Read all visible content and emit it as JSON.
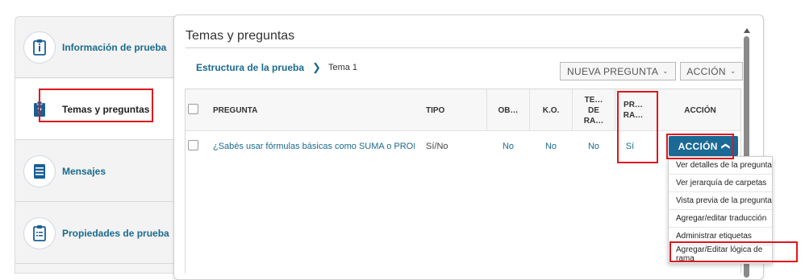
{
  "sidebar": {
    "items": [
      {
        "label": "Información de prueba",
        "icon": "info-icon"
      },
      {
        "label": "Temas y preguntas",
        "icon": "clipboard-question-icon",
        "active": true
      },
      {
        "label": "Mensajes",
        "icon": "message-icon"
      },
      {
        "label": "Propiedades de prueba",
        "icon": "document-list-icon"
      }
    ]
  },
  "panel": {
    "title": "Temas y preguntas"
  },
  "breadcrumb": {
    "root": "Estructura de la prueba",
    "current": "Tema 1"
  },
  "toolbar": {
    "new_question": "NUEVA PREGUNTA",
    "action": "ACCIÓN"
  },
  "table": {
    "headers": {
      "question": "PREGUNTA",
      "type": "TIPO",
      "ob": "OB…",
      "ko": "K.O.",
      "te": [
        "TE…",
        "DE",
        "RA…"
      ],
      "pr": [
        "PR…",
        "RA…"
      ],
      "action": "ACCIÓN"
    },
    "rows": [
      {
        "question": "¿Sabés usar fórmulas básicas como SUMA o PROMEDIC",
        "type": "Sí/No",
        "ob": "No",
        "ko": "No",
        "te": "No",
        "pr": "Sí",
        "action": "ACCIÓN"
      }
    ]
  },
  "action_menu": {
    "items": [
      "Ver detalles de la pregunta",
      "Ver jerarquía de carpetas",
      "Vista previa de la pregunta",
      "Agregar/editar traducción",
      "Administrar etiquetas",
      "Agregar/Editar lógica de rama"
    ]
  },
  "colors": {
    "accent": "#1b6a96",
    "link": "#1b6a8e",
    "highlight": "#e0151c"
  }
}
